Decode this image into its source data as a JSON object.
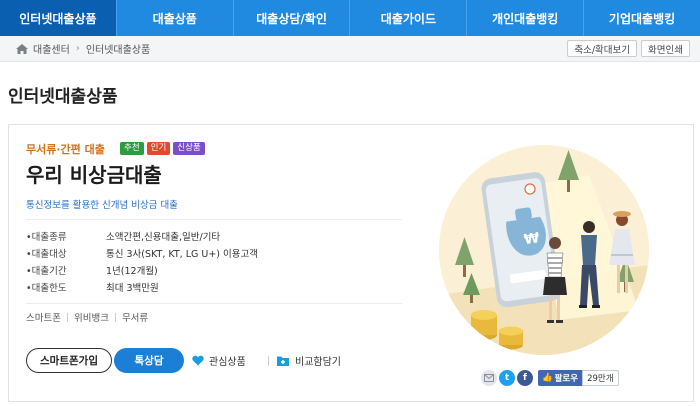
{
  "nav": {
    "tabs": [
      {
        "label": "인터넷대출상품",
        "active": true
      },
      {
        "label": "대출상품"
      },
      {
        "label": "대출상담/확인"
      },
      {
        "label": "대출가이드"
      },
      {
        "label": "개인대출뱅킹"
      },
      {
        "label": "기업대출뱅킹"
      }
    ]
  },
  "breadcrumb": {
    "root": "대출센터",
    "current": "인터넷대출상품",
    "zoom_button": "축소/확대보기",
    "print_button": "화면인쇄"
  },
  "page_title": "인터넷대출상품",
  "product": {
    "category": "무서류·간편 대출",
    "badges": [
      {
        "label": "추천",
        "color": "#2f9a3f"
      },
      {
        "label": "인기",
        "color": "#e04b2e"
      },
      {
        "label": "신상품",
        "color": "#7a4fc9"
      }
    ],
    "name": "우리 비상금대출",
    "description": "통신정보를 활용한 신개념 비상금 대출",
    "specs": [
      {
        "label": "•대출종류",
        "value": "소액간편,신용대출,일반/기타"
      },
      {
        "label": "•대출대상",
        "value": "통신 3사(SKT, KT, LG U+) 이용고객"
      },
      {
        "label": "•대출기간",
        "value": "1년(12개월)"
      },
      {
        "label": "•대출한도",
        "value": "최대 3백만원"
      }
    ],
    "tags": [
      "스마트폰",
      "위비뱅크",
      "무서류"
    ],
    "buttons": {
      "mobile_apply": "스마트폰가입",
      "quick_consult": "톡상담",
      "favorite": "관심상품",
      "compare": "비교함담기"
    }
  },
  "social": {
    "follow_label": "팔로우",
    "follow_count": "29만개"
  },
  "colors": {
    "nav_bg": "#2089e0",
    "nav_active": "#0b5fb0",
    "category": "#d4721a",
    "desc": "#2b6fc8",
    "primary_button": "#1b7fd6"
  }
}
